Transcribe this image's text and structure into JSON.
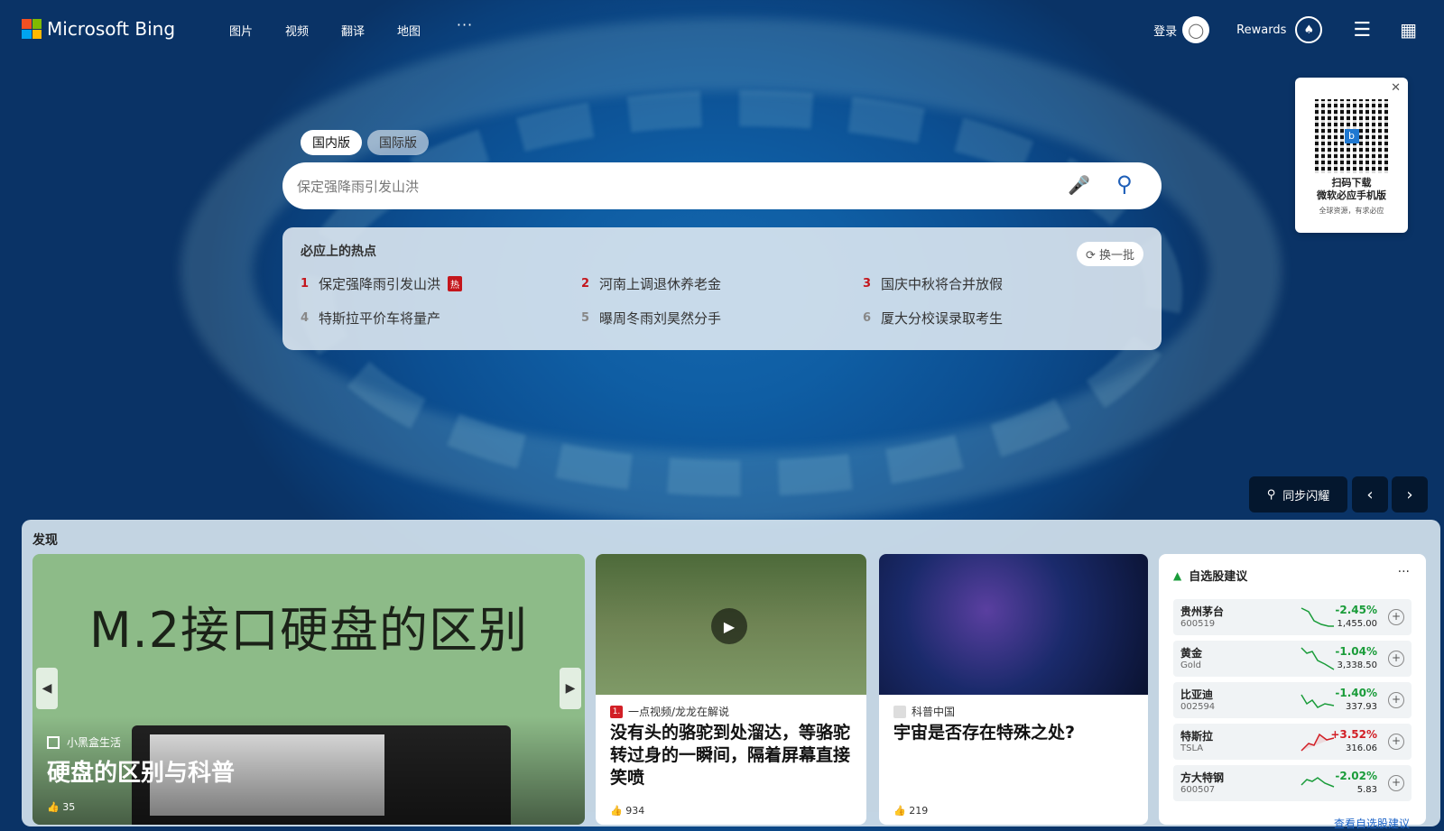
{
  "brand": "Microsoft Bing",
  "nav": [
    "图片",
    "视频",
    "翻译",
    "地图",
    "···"
  ],
  "header": {
    "login": "登录",
    "rewards": "Rewards"
  },
  "qr": {
    "line1": "扫码下载",
    "line2": "微软必应手机版",
    "line3": "全球资源，有求必应"
  },
  "tabs": [
    "国内版",
    "国际版"
  ],
  "search": {
    "placeholder": "保定强降雨引发山洪"
  },
  "hot": {
    "title": "必应上的热点",
    "refresh": "换一批",
    "badge": "热",
    "items": [
      {
        "num": "1",
        "text": "保定强降雨引发山洪"
      },
      {
        "num": "2",
        "text": "河南上调退休养老金"
      },
      {
        "num": "3",
        "text": "国庆中秋将合并放假"
      },
      {
        "num": "4",
        "text": "特斯拉平价车将量产"
      },
      {
        "num": "5",
        "text": "曝周冬雨刘昊然分手"
      },
      {
        "num": "6",
        "text": "厦大分校误录取考生"
      }
    ]
  },
  "location_button": "同步闪耀",
  "discover": {
    "title": "发现",
    "big": {
      "image_text": "M.2接口硬盘的区别",
      "source": "小黑盒生活",
      "headline": "硬盘的区别与科普",
      "likes": "35"
    },
    "cards": [
      {
        "source": "一点视频/龙龙在解说",
        "source_icon": "1.",
        "headline": "没有头的骆驼到处溜达，等骆驼转过身的一瞬间，隔着屏幕直接笑喷",
        "likes": "934"
      },
      {
        "source": "科普中国",
        "headline": "宇宙是否存在特殊之处?",
        "likes": "219"
      }
    ]
  },
  "stocks": {
    "title": "自选股建议",
    "rows": [
      {
        "name": "贵州茅台",
        "code": "600519",
        "change": "-2.45%",
        "price": "1,455.00",
        "dir": "neg"
      },
      {
        "name": "黄金",
        "code": "Gold",
        "change": "-1.04%",
        "price": "3,338.50",
        "dir": "neg"
      },
      {
        "name": "比亚迪",
        "code": "002594",
        "change": "-1.40%",
        "price": "337.93",
        "dir": "neg"
      },
      {
        "name": "特斯拉",
        "code": "TSLA",
        "change": "+3.52%",
        "price": "316.06",
        "dir": "pos"
      },
      {
        "name": "方大特钢",
        "code": "600507",
        "change": "-2.02%",
        "price": "5.83",
        "dir": "neg"
      }
    ],
    "more": "查看自选股建议"
  },
  "colors": {
    "accent": "#1f5fb8",
    "hot_red": "#c4161c",
    "stock_up": "#d21f26",
    "stock_down": "#1a9c3a"
  }
}
